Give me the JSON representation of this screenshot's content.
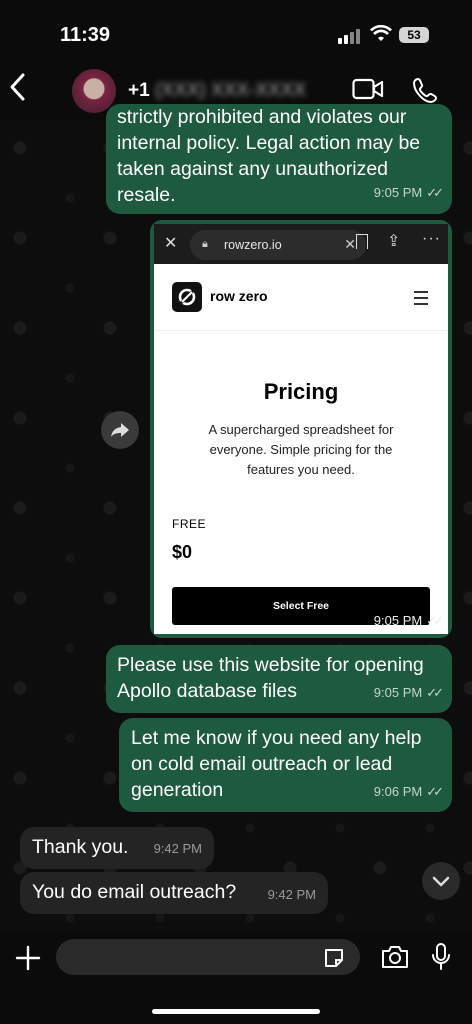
{
  "status_bar": {
    "time": "11:39",
    "battery": "53"
  },
  "header": {
    "contact_prefix": "+1",
    "contact_number_blurred": "(XXX) XXX-XXXX"
  },
  "messages": [
    {
      "text": "strictly prohibited and violates our internal policy. Legal action may be taken against any unauthorized resale.",
      "time": "9:05 PM"
    },
    {
      "time": "9:05 PM"
    },
    {
      "text": "Please use this website for opening Apollo database files",
      "time": "9:05 PM"
    },
    {
      "text": "Let me know if you need any help on cold email outreach or lead generation",
      "time": "9:06 PM"
    },
    {
      "text": "Thank you.",
      "time": "9:42 PM"
    },
    {
      "text": "You do email outreach?",
      "time": "9:42 PM"
    }
  ],
  "screenshot": {
    "url": "rowzero.io",
    "brand": "row zero",
    "heading": "Pricing",
    "description": "A supercharged spreadsheet for everyone. Simple pricing for the features you need.",
    "plan": "FREE",
    "price": "$0",
    "cta": "Select Free"
  },
  "icons": [
    "back-icon",
    "video-call-icon",
    "phone-icon",
    "forward-icon",
    "chevron-down-icon",
    "plus-icon",
    "sticker-icon",
    "camera-icon",
    "microphone-icon",
    "read-receipt-icon"
  ]
}
